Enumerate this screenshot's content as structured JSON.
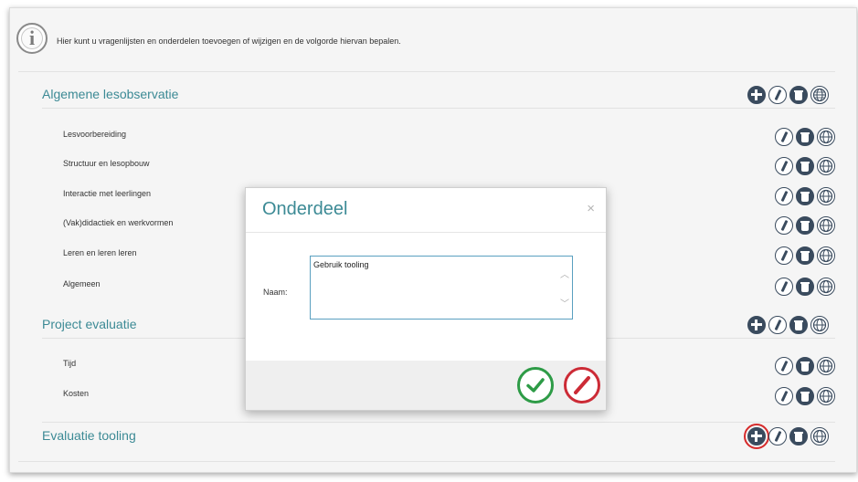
{
  "info": {
    "icon": "info-icon",
    "glyph": "i",
    "text": "Hier kunt u vragenlijsten en onderdelen toevoegen of wijzigen en de volgorde hiervan bepalen."
  },
  "sections": [
    {
      "title": "Algemene lesobservatie",
      "items": [
        "Lesvoorbereiding",
        "Structuur en lesopbouw",
        "Interactie met leerlingen",
        "(Vak)didactiek en werkvormen",
        "Leren en leren leren",
        "Algemeen"
      ]
    },
    {
      "title": "Project evaluatie",
      "items": [
        "Tijd",
        "Kosten"
      ]
    },
    {
      "title": "Evaluatie tooling",
      "items": []
    }
  ],
  "icons": {
    "add": "plus-icon",
    "edit": "pencil-icon",
    "delete": "trash-icon",
    "translate": "globe-icon"
  },
  "modal": {
    "title": "Onderdeel",
    "close": "×",
    "name_label": "Naam:",
    "name_value": "Gebruik tooling",
    "scroll_up": "︿",
    "scroll_down": "﹀",
    "confirm": "check-icon",
    "cancel": "cancel-slash-icon"
  },
  "colors": {
    "accent_teal": "#3c8a95",
    "icon_dark": "#3a4b5e",
    "confirm_green": "#2d9b46",
    "cancel_red": "#cc2b36",
    "highlight_red": "#d62b2b"
  }
}
